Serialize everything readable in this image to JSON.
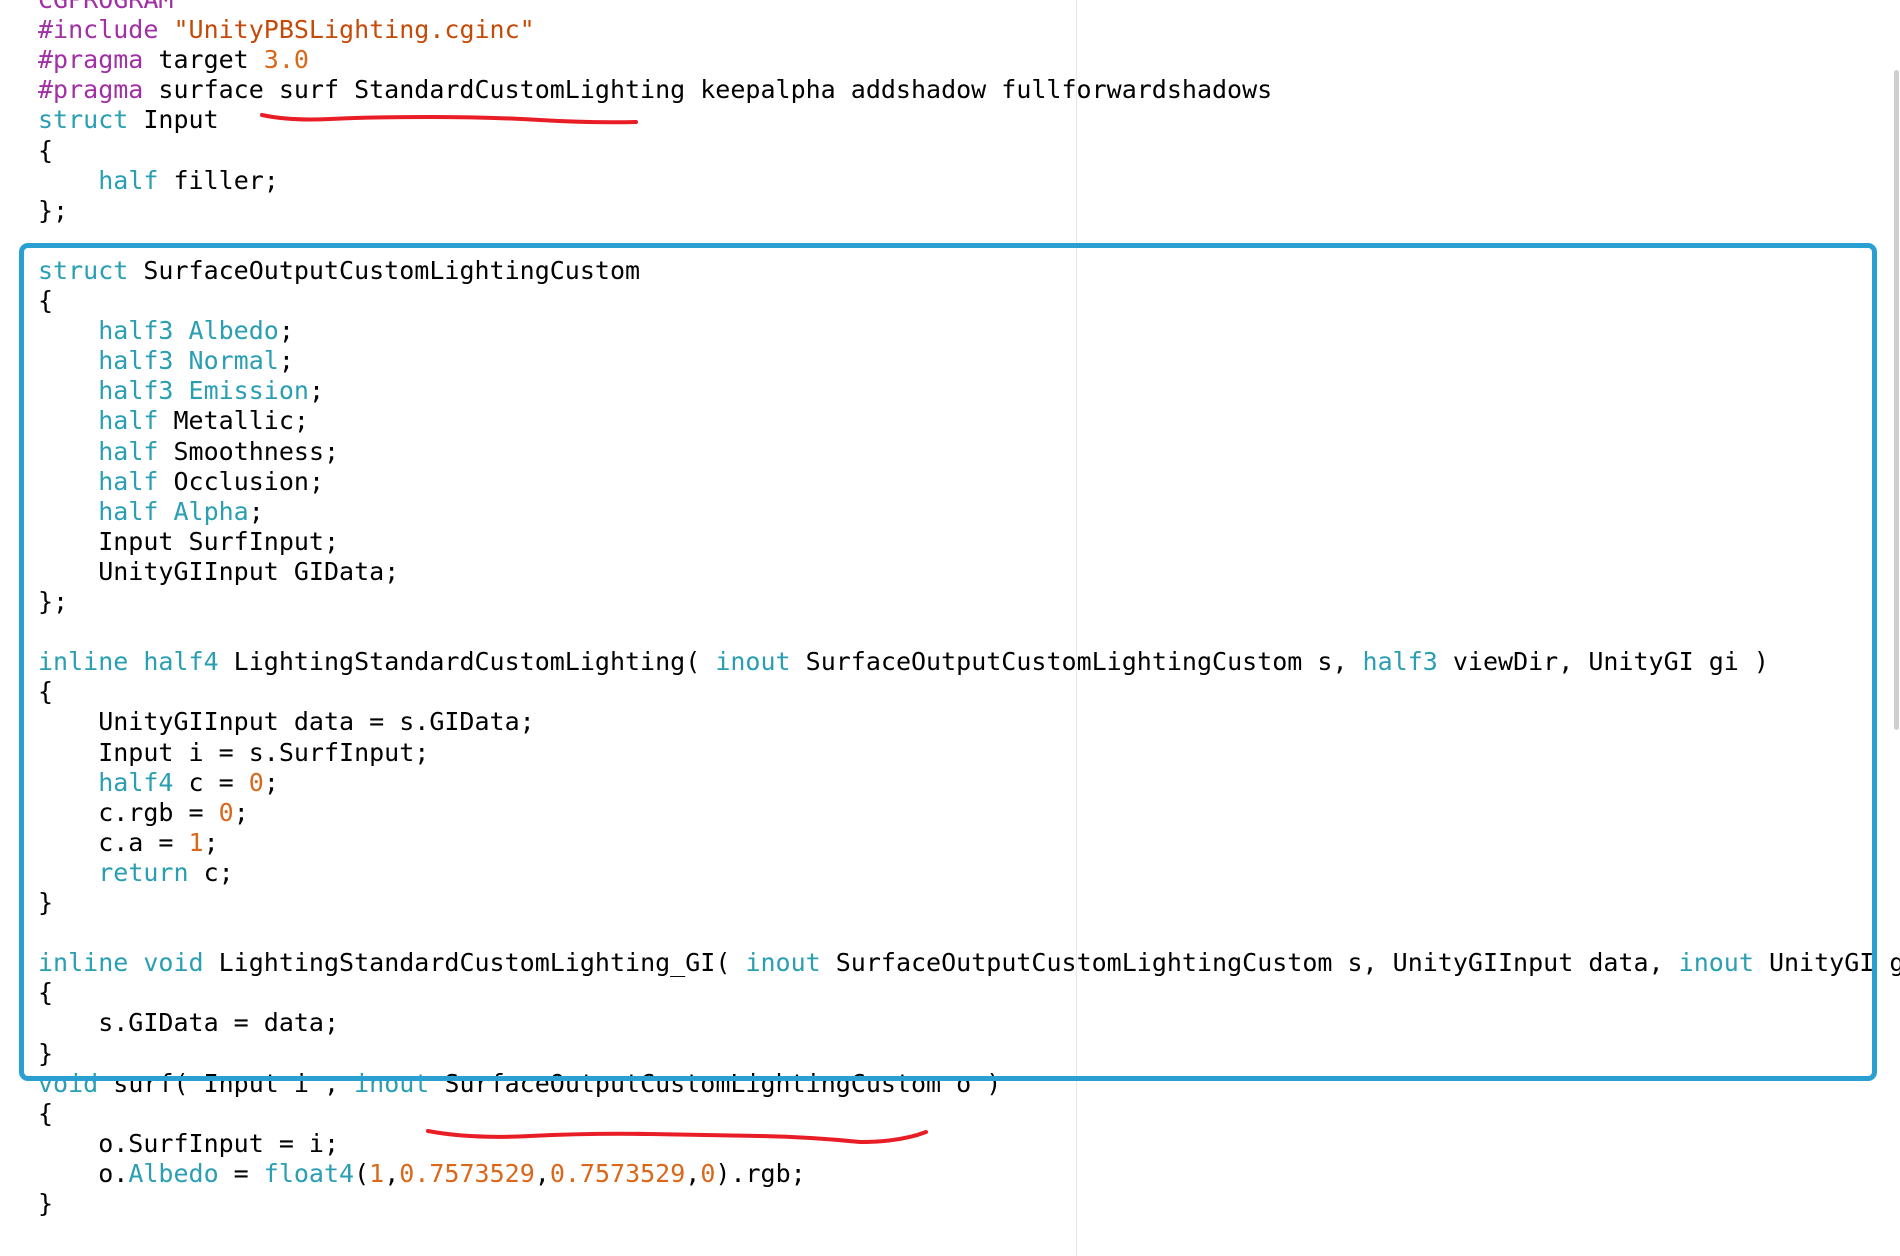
{
  "editor": {
    "colors": {
      "background": "#ffffff",
      "keyword": "#2a9eb3",
      "preprocessor": "#a12fa5",
      "string": "#c54a08",
      "number": "#d9681b",
      "plain": "#000000",
      "highlight_box": "#2a9fd2",
      "underline": "#e81d25"
    },
    "lines": [
      [
        [
          "pp",
          "CGPROGRAM"
        ]
      ],
      [
        [
          "pp",
          "#include "
        ],
        [
          "str",
          "\"UnityPBSLighting.cginc\""
        ]
      ],
      [
        [
          "pp",
          "#pragma"
        ],
        [
          "pl",
          " target "
        ],
        [
          "num",
          "3.0"
        ]
      ],
      [
        [
          "pp",
          "#pragma"
        ],
        [
          "pl",
          " surface surf StandardCustomLighting keepalpha addshadow fullforwardshadows"
        ]
      ],
      [
        [
          "kw",
          "struct"
        ],
        [
          "pl",
          " Input"
        ]
      ],
      [
        [
          "pl",
          "{"
        ]
      ],
      [
        [
          "pl",
          "    "
        ],
        [
          "kw",
          "half"
        ],
        [
          "pl",
          " filler;"
        ]
      ],
      [
        [
          "pl",
          "};"
        ]
      ],
      [
        [
          "pl",
          ""
        ]
      ],
      [
        [
          "kw",
          "struct"
        ],
        [
          "pl",
          " SurfaceOutputCustomLightingCustom"
        ]
      ],
      [
        [
          "pl",
          "{"
        ]
      ],
      [
        [
          "pl",
          "    "
        ],
        [
          "kw",
          "half3 Albedo"
        ],
        [
          "pl",
          ";"
        ]
      ],
      [
        [
          "pl",
          "    "
        ],
        [
          "kw",
          "half3 Normal"
        ],
        [
          "pl",
          ";"
        ]
      ],
      [
        [
          "pl",
          "    "
        ],
        [
          "kw",
          "half3 Emission"
        ],
        [
          "pl",
          ";"
        ]
      ],
      [
        [
          "pl",
          "    "
        ],
        [
          "kw",
          "half"
        ],
        [
          "pl",
          " Metallic;"
        ]
      ],
      [
        [
          "pl",
          "    "
        ],
        [
          "kw",
          "half"
        ],
        [
          "pl",
          " Smoothness;"
        ]
      ],
      [
        [
          "pl",
          "    "
        ],
        [
          "kw",
          "half"
        ],
        [
          "pl",
          " Occlusion;"
        ]
      ],
      [
        [
          "pl",
          "    "
        ],
        [
          "kw",
          "half Alpha"
        ],
        [
          "pl",
          ";"
        ]
      ],
      [
        [
          "pl",
          "    Input SurfInput;"
        ]
      ],
      [
        [
          "pl",
          "    UnityGIInput GIData;"
        ]
      ],
      [
        [
          "pl",
          "};"
        ]
      ],
      [
        [
          "pl",
          ""
        ]
      ],
      [
        [
          "kw",
          "inline half4"
        ],
        [
          "pl",
          " LightingStandardCustomLighting( "
        ],
        [
          "kw",
          "inout"
        ],
        [
          "pl",
          " SurfaceOutputCustomLightingCustom s, "
        ],
        [
          "kw",
          "half3"
        ],
        [
          "pl",
          " viewDir, UnityGI gi )"
        ]
      ],
      [
        [
          "pl",
          "{"
        ]
      ],
      [
        [
          "pl",
          "    UnityGIInput data = s.GIData;"
        ]
      ],
      [
        [
          "pl",
          "    Input i = s.SurfInput;"
        ]
      ],
      [
        [
          "pl",
          "    "
        ],
        [
          "kw",
          "half4"
        ],
        [
          "pl",
          " c = "
        ],
        [
          "num",
          "0"
        ],
        [
          "pl",
          ";"
        ]
      ],
      [
        [
          "pl",
          "    c.rgb = "
        ],
        [
          "num",
          "0"
        ],
        [
          "pl",
          ";"
        ]
      ],
      [
        [
          "pl",
          "    c.a = "
        ],
        [
          "num",
          "1"
        ],
        [
          "pl",
          ";"
        ]
      ],
      [
        [
          "pl",
          "    "
        ],
        [
          "kw",
          "return"
        ],
        [
          "pl",
          " c;"
        ]
      ],
      [
        [
          "pl",
          "}"
        ]
      ],
      [
        [
          "pl",
          ""
        ]
      ],
      [
        [
          "kw",
          "inline void"
        ],
        [
          "pl",
          " LightingStandardCustomLighting_GI( "
        ],
        [
          "kw",
          "inout"
        ],
        [
          "pl",
          " SurfaceOutputCustomLightingCustom s, UnityGIInput data, "
        ],
        [
          "kw",
          "inout"
        ],
        [
          "pl",
          " UnityGI gi )"
        ]
      ],
      [
        [
          "pl",
          "{"
        ]
      ],
      [
        [
          "pl",
          "    s.GIData = data;"
        ]
      ],
      [
        [
          "pl",
          "}"
        ]
      ],
      [
        [
          "kw",
          "void"
        ],
        [
          "pl",
          " surf( Input i , "
        ],
        [
          "kw",
          "inout"
        ],
        [
          "pl",
          " SurfaceOutputCustomLightingCustom o )"
        ]
      ],
      [
        [
          "pl",
          "{"
        ]
      ],
      [
        [
          "pl",
          "    o.SurfInput = i;"
        ]
      ],
      [
        [
          "pl",
          "    o."
        ],
        [
          "kw",
          "Albedo"
        ],
        [
          "pl",
          " = "
        ],
        [
          "kw",
          "float4"
        ],
        [
          "pl",
          "("
        ],
        [
          "num",
          "1"
        ],
        [
          "pl",
          ","
        ],
        [
          "num",
          "0.7573529"
        ],
        [
          "pl",
          ","
        ],
        [
          "num",
          "0.7573529"
        ],
        [
          "pl",
          ","
        ],
        [
          "num",
          "0"
        ],
        [
          "pl",
          ").rgb;"
        ]
      ],
      [
        [
          "pl",
          "}"
        ]
      ]
    ]
  }
}
